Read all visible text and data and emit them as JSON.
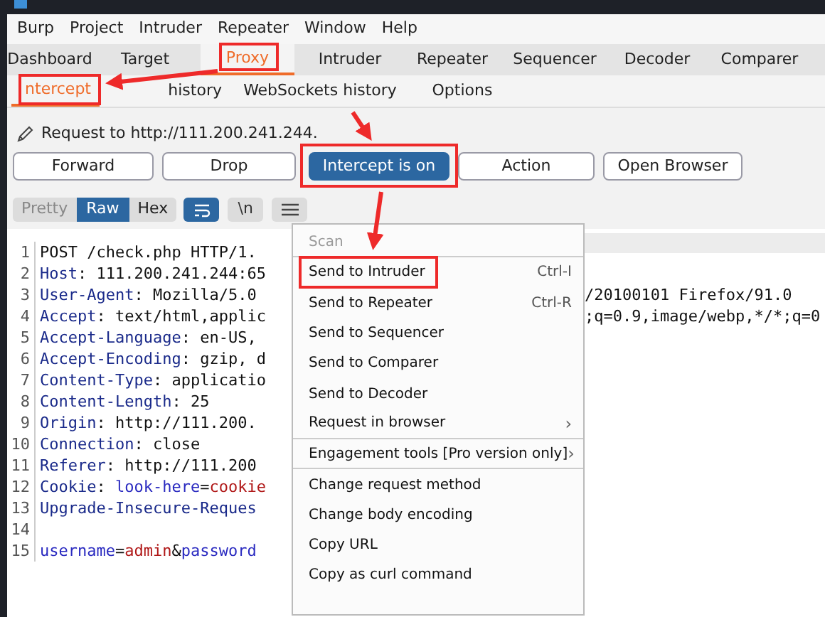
{
  "menu_bar": [
    "Burp",
    "Project",
    "Intruder",
    "Repeater",
    "Window",
    "Help"
  ],
  "tabs": [
    {
      "label": "Dashboard",
      "selected": false
    },
    {
      "label": "Target",
      "selected": false
    },
    {
      "label": "Proxy",
      "selected": true
    },
    {
      "label": "Intruder",
      "selected": false
    },
    {
      "label": "Repeater",
      "selected": false
    },
    {
      "label": "Sequencer",
      "selected": false
    },
    {
      "label": "Decoder",
      "selected": false
    },
    {
      "label": "Comparer",
      "selected": false
    }
  ],
  "sub_tabs": [
    {
      "label": "ntercept",
      "selected": true
    },
    {
      "label": "history",
      "selected": false
    },
    {
      "label": "WebSockets history",
      "selected": false
    },
    {
      "label": "Options",
      "selected": false
    }
  ],
  "request_title": "Request to http://111.200.241.244.",
  "actions": [
    {
      "label": "Forward",
      "selected": false
    },
    {
      "label": "Drop",
      "selected": false
    },
    {
      "label": "Intercept is on",
      "selected": true
    },
    {
      "label": "Action",
      "selected": false
    },
    {
      "label": "Open Browser",
      "selected": false
    }
  ],
  "view_tabs": [
    {
      "label": "Pretty",
      "selected": false
    },
    {
      "label": "Raw",
      "selected": true
    },
    {
      "label": "Hex",
      "selected": false
    }
  ],
  "editor_buttons": [
    {
      "kind": "wrap",
      "on": true
    },
    {
      "kind": "newline",
      "label": "\\n",
      "on": false
    },
    {
      "kind": "menu",
      "on": false
    }
  ],
  "lines": [
    {
      "number": "1",
      "segments": [
        {
          "kind": "plain",
          "text": "POST /check.php HTTP/1."
        }
      ]
    },
    {
      "number": "2",
      "segments": [
        {
          "kind": "name",
          "text": "Host"
        },
        {
          "kind": "plain",
          "text": ": 111.200.241.244:65"
        }
      ]
    },
    {
      "number": "3",
      "segments": [
        {
          "kind": "name",
          "text": "User-Agent"
        },
        {
          "kind": "plain",
          "text": ": Mozilla/5.0"
        }
      ],
      "right": "/20100101 Firefox/91.0"
    },
    {
      "number": "4",
      "segments": [
        {
          "kind": "name",
          "text": "Accept"
        },
        {
          "kind": "plain",
          "text": ": text/html,applic"
        }
      ],
      "right": ";q=0.9,image/webp,*/*;q=0"
    },
    {
      "number": "5",
      "segments": [
        {
          "kind": "name",
          "text": "Accept-Language"
        },
        {
          "kind": "plain",
          "text": ": en-US,"
        }
      ]
    },
    {
      "number": "6",
      "segments": [
        {
          "kind": "name",
          "text": "Accept-Encoding"
        },
        {
          "kind": "plain",
          "text": ": gzip, d"
        }
      ]
    },
    {
      "number": "7",
      "segments": [
        {
          "kind": "name",
          "text": "Content-Type"
        },
        {
          "kind": "plain",
          "text": ": applicatio"
        }
      ]
    },
    {
      "number": "8",
      "segments": [
        {
          "kind": "name",
          "text": "Content-Length"
        },
        {
          "kind": "plain",
          "text": ": 25"
        }
      ]
    },
    {
      "number": "9",
      "segments": [
        {
          "kind": "name",
          "text": "Origin"
        },
        {
          "kind": "plain",
          "text": ": http://111.200."
        }
      ]
    },
    {
      "number": "10",
      "segments": [
        {
          "kind": "name",
          "text": "Connection"
        },
        {
          "kind": "plain",
          "text": ": close"
        }
      ]
    },
    {
      "number": "11",
      "segments": [
        {
          "kind": "name",
          "text": "Referer"
        },
        {
          "kind": "plain",
          "text": ": http://111.200"
        }
      ]
    },
    {
      "number": "12",
      "segments": [
        {
          "kind": "name",
          "text": "Cookie"
        },
        {
          "kind": "plain",
          "text": ": "
        },
        {
          "kind": "param",
          "text": "look-here"
        },
        {
          "kind": "plain",
          "text": "="
        },
        {
          "kind": "value",
          "text": "cookie"
        }
      ]
    },
    {
      "number": "13",
      "segments": [
        {
          "kind": "name",
          "text": "Upgrade-Insecure-Reques"
        }
      ]
    },
    {
      "number": "14"
    },
    {
      "number": "15",
      "segments": [
        {
          "kind": "param",
          "text": "username"
        },
        {
          "kind": "plain",
          "text": "="
        },
        {
          "kind": "value",
          "text": "admin"
        },
        {
          "kind": "plain",
          "text": "&"
        },
        {
          "kind": "param",
          "text": "password"
        }
      ]
    }
  ],
  "context_menu": [
    {
      "label": "Scan",
      "disabled": true,
      "separator_after": true
    },
    {
      "label": "Send to Intruder",
      "shortcut": "Ctrl-I",
      "disabled": false,
      "separator_after": false
    },
    {
      "label": "Send to Repeater",
      "shortcut": "Ctrl-R",
      "disabled": false,
      "separator_after": false
    },
    {
      "label": "Send to Sequencer",
      "disabled": false,
      "separator_after": false
    },
    {
      "label": "Send to Comparer",
      "disabled": false,
      "separator_after": false
    },
    {
      "label": "Send to Decoder",
      "disabled": false,
      "separator_after": false
    },
    {
      "label": "Request in browser",
      "arrow": "›",
      "disabled": false,
      "separator_after": true
    },
    {
      "label": "Engagement tools [Pro version only]",
      "arrow": "›",
      "disabled": false,
      "separator_after": true
    },
    {
      "label": "Change request method",
      "disabled": false,
      "separator_after": false
    },
    {
      "label": "Change body encoding",
      "disabled": false,
      "separator_after": false
    },
    {
      "label": "Copy URL",
      "disabled": false,
      "separator_after": false
    },
    {
      "label": "Copy as curl command",
      "disabled": false,
      "separator_after": false
    }
  ]
}
